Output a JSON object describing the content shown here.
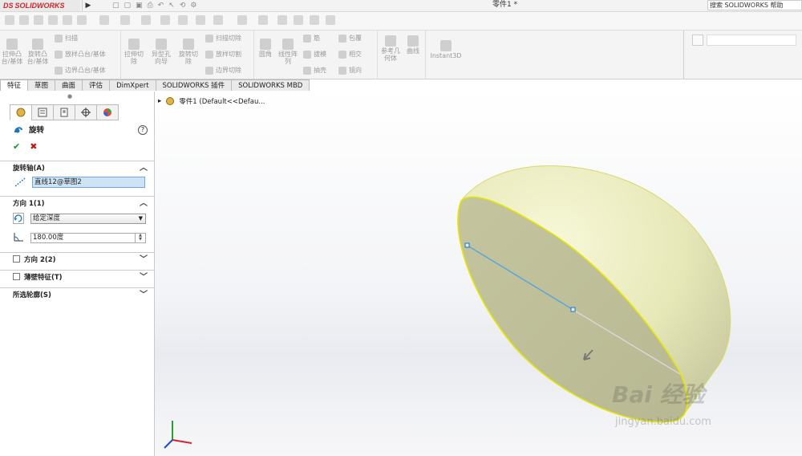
{
  "titlebar": {
    "brand_prefix": "DS",
    "brand_name": "SOLIDWORKS",
    "document_title": "零件1 *",
    "help_search": "搜索 SOLIDWORKS 帮助"
  },
  "ribbon": {
    "features": [
      {
        "label": "拉伸凸台/基体"
      },
      {
        "label": "旋转凸台/基体"
      }
    ],
    "sweep_group": [
      "扫描",
      "放样凸台/基体",
      "边界凸台/基体"
    ],
    "cut_buttons": [
      {
        "label": "拉伸切除"
      },
      {
        "label": "异型孔向导"
      },
      {
        "label": "旋转切除"
      }
    ],
    "cut_items": [
      "扫描切除",
      "放样切割",
      "边界切除"
    ],
    "fillet": "圆角",
    "linear_pattern": "线性阵列",
    "mid_items": [
      "筋",
      "拔模",
      "抽壳"
    ],
    "right_items": [
      "包覆",
      "相交",
      "镜向"
    ],
    "reference": "参考几何体",
    "curves": "曲线",
    "instant3d": "Instant3D"
  },
  "tabs": [
    {
      "label": "特征"
    },
    {
      "label": "草图"
    },
    {
      "label": "曲面"
    },
    {
      "label": "评估"
    },
    {
      "label": "DimXpert"
    },
    {
      "label": "SOLIDWORKS 插件"
    },
    {
      "label": "SOLIDWORKS MBD"
    }
  ],
  "panel": {
    "title": "旋转",
    "help": "?",
    "ok": "✔",
    "cancel": "✖",
    "axis_section": "旋转轴(A)",
    "axis_value": "直线12@草图2",
    "dir1_section": "方向 1(1)",
    "dir1_type": "给定深度",
    "angle": "180.00度",
    "dir2_section": "方向 2(2)",
    "thin_section": "薄壁特征(T)",
    "contours_section": "所选轮廓(S)"
  },
  "tree": {
    "root": "零件1  (Default<<Defau..."
  },
  "watermark": {
    "text": "Bai 经验",
    "url": "jingyan.baidu.com"
  },
  "colors": {
    "accent": "#1a75bc",
    "ok": "#1d8f2b",
    "cancel": "#c0161d",
    "model_face": "#edeec4",
    "model_edge": "#e6e600"
  }
}
